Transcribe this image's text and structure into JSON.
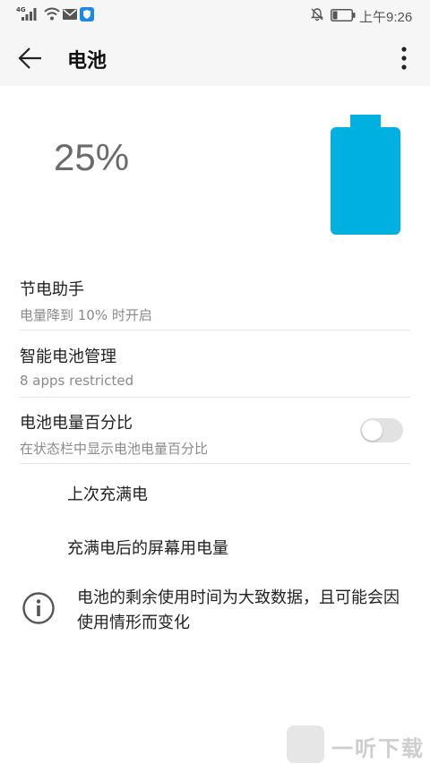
{
  "status_bar": {
    "network_type": "4G",
    "time": "上午9:26",
    "battery_level": 0.25,
    "icons": [
      "signal-icon",
      "wifi-icon",
      "mail-icon",
      "shield-icon",
      "bell-off-icon",
      "battery-icon"
    ]
  },
  "header": {
    "title": "电池",
    "back_icon": "arrow-left-icon",
    "more_icon": "more-vertical-icon"
  },
  "battery": {
    "percent_text": "25%",
    "level": 0.25,
    "color": "#00b0e0"
  },
  "settings": {
    "power_saving": {
      "title": "节电助手",
      "subtitle": "电量降到 10% 时开启"
    },
    "smart_management": {
      "title": "智能电池管理",
      "subtitle": "8 apps restricted"
    },
    "percentage": {
      "title": "电池电量百分比",
      "subtitle": "在状态栏中显示电池电量百分比",
      "enabled": false
    }
  },
  "sections": {
    "last_full_charge": "上次充满电",
    "screen_usage": "充满电后的屏幕用电量"
  },
  "info": {
    "icon": "info-icon",
    "text": "电池的剩余使用时间为大致数据，且可能会因使用情形而变化"
  },
  "watermark": {
    "text": "一听下载"
  }
}
